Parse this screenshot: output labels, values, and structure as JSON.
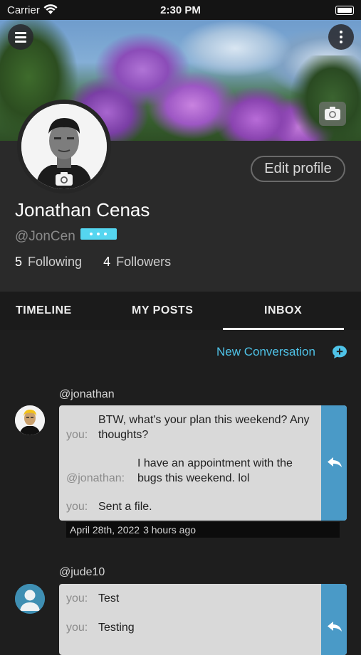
{
  "status_bar": {
    "carrier": "Carrier",
    "time": "2:30 PM"
  },
  "profile": {
    "name": "Jonathan Cenas",
    "handle": "@JonCen",
    "edit_label": "Edit profile",
    "following_count": "5",
    "following_label": "Following",
    "followers_count": "4",
    "followers_label": "Followers"
  },
  "tabs": [
    {
      "label": "TIMELINE",
      "active": false
    },
    {
      "label": "MY POSTS",
      "active": false
    },
    {
      "label": "INBOX",
      "active": true
    }
  ],
  "new_conversation_label": "New Conversation",
  "conversations": [
    {
      "user": "@jonathan",
      "messages": [
        {
          "who": "you:",
          "text": "BTW, what's your plan this weekend? Any thoughts?"
        },
        {
          "who": "@jonathan:",
          "text": "I have an appointment with the bugs this weekend. lol"
        },
        {
          "who": "you:",
          "text": "Sent a file."
        }
      ],
      "date": "April 28th, 2022",
      "ago": "3 hours ago"
    },
    {
      "user": "@jude10",
      "messages": [
        {
          "who": "you:",
          "text": "Test"
        },
        {
          "who": "you:",
          "text": "Testing"
        }
      ]
    }
  ],
  "colors": {
    "accent": "#4fc3e8",
    "reply_bar": "#4a9ac7",
    "badge": "#55d6f0"
  }
}
